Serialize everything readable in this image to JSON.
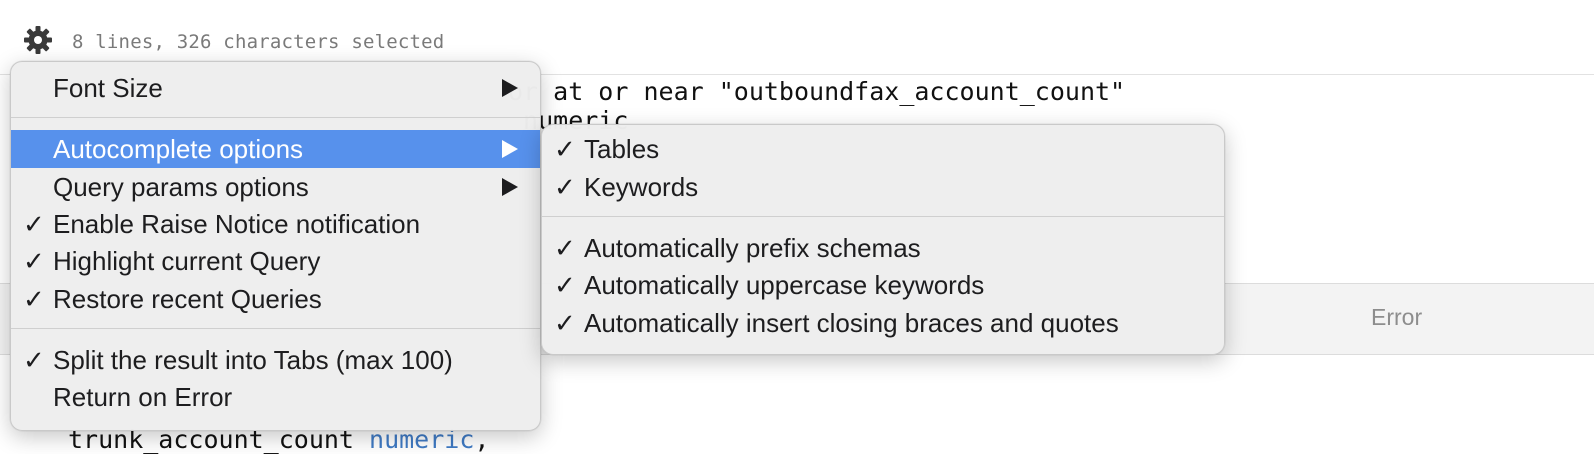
{
  "status": {
    "gear_icon": "gear-icon",
    "selection_text": "8 lines, 326 characters selected"
  },
  "editor": {
    "line1": "or at or near \"outboundfax_account_count\"",
    "line2": " numeric"
  },
  "results": {
    "error_tab": "Error"
  },
  "bottom_code": {
    "identifier": "trunk_account_count ",
    "type": "numeric",
    "suffix": ","
  },
  "colors": {
    "highlight": "#5791ec",
    "keyword": "#3f7ac4"
  },
  "main_menu": {
    "items": [
      {
        "label": "Font Size",
        "checked": false,
        "has_submenu": true
      },
      {
        "label": "Autocomplete options",
        "checked": false,
        "has_submenu": true,
        "highlighted": true
      },
      {
        "label": "Query params options",
        "checked": false,
        "has_submenu": true
      },
      {
        "label": "Enable Raise Notice notification",
        "checked": true
      },
      {
        "label": "Highlight current Query",
        "checked": true
      },
      {
        "label": "Restore recent Queries",
        "checked": true
      },
      {
        "label": "Split the result into Tabs (max 100)",
        "checked": true
      },
      {
        "label": "Return on Error",
        "checked": false
      }
    ]
  },
  "autocomplete_submenu": {
    "items": [
      {
        "label": "Tables",
        "checked": true
      },
      {
        "label": "Keywords",
        "checked": true
      },
      {
        "label": "Automatically prefix schemas",
        "checked": true
      },
      {
        "label": "Automatically uppercase keywords",
        "checked": true
      },
      {
        "label": "Automatically insert closing braces and quotes",
        "checked": true
      }
    ]
  },
  "check_glyph": "✓"
}
